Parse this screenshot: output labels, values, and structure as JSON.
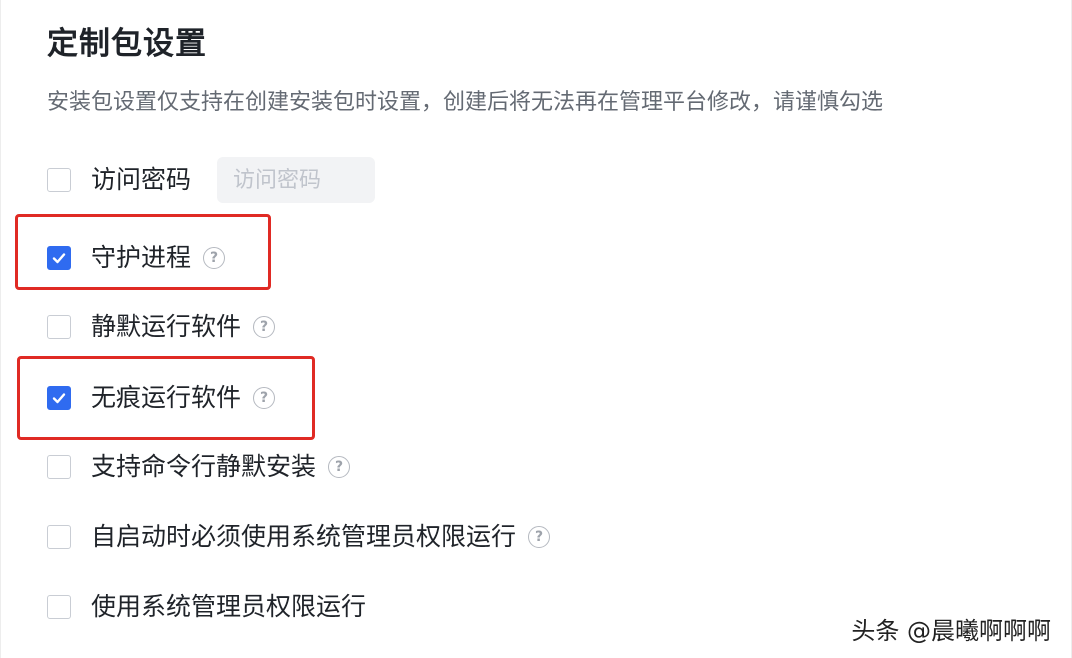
{
  "section": {
    "title": "定制包设置",
    "description": "安装包设置仅支持在创建安装包时设置，创建后将无法再在管理平台修改，请谨慎勾选"
  },
  "options": [
    {
      "label": "访问密码",
      "checked": false,
      "has_help": false,
      "input_placeholder": "访问密码"
    },
    {
      "label": "守护进程",
      "checked": true,
      "has_help": true
    },
    {
      "label": "静默运行软件",
      "checked": false,
      "has_help": true
    },
    {
      "label": "无痕运行软件",
      "checked": true,
      "has_help": true
    },
    {
      "label": "支持命令行静默安装",
      "checked": false,
      "has_help": true
    },
    {
      "label": "自启动时必须使用系统管理员权限运行",
      "checked": false,
      "has_help": true
    },
    {
      "label": "使用系统管理员权限运行",
      "checked": false,
      "has_help": false
    }
  ],
  "help_icon_glyph": "?",
  "colors": {
    "accent": "#2f6bf0",
    "highlight": "#e02a24",
    "text": "#1f2329",
    "muted": "#646a73"
  },
  "watermark": "头条 @晨曦啊啊啊"
}
